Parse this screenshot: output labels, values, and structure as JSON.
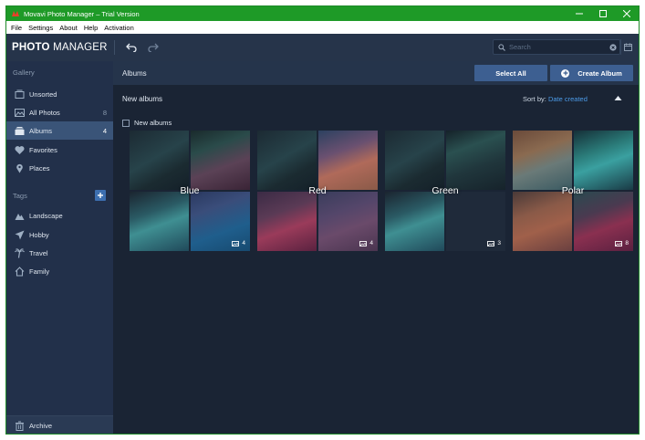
{
  "window": {
    "title": "Movavi Photo Manager – Trial Version",
    "accent_color": "#1e9a27",
    "controls": [
      "minimize-icon",
      "maximize-icon",
      "close-icon"
    ]
  },
  "menu": [
    "File",
    "Settings",
    "About",
    "Help",
    "Activation"
  ],
  "toolbar": {
    "logo_bold": "PHOTO",
    "logo_light": " MANAGER",
    "undo_icon": "undo-icon",
    "redo_icon": "redo-icon",
    "search_placeholder": "Search",
    "calendar_icon": "calendar-icon"
  },
  "sidebar": {
    "gallery_heading": "Gallery",
    "gallery_items": [
      {
        "label": "Unsorted",
        "count": "",
        "icon": "unsorted-icon"
      },
      {
        "label": "All Photos",
        "count": "8",
        "icon": "photos-icon"
      },
      {
        "label": "Albums",
        "count": "4",
        "icon": "albums-icon",
        "active": true
      },
      {
        "label": "Favorites",
        "count": "",
        "icon": "heart-icon"
      },
      {
        "label": "Places",
        "count": "",
        "icon": "pin-icon"
      }
    ],
    "tags_heading": "Tags",
    "tags": [
      {
        "label": "Landscape",
        "icon": "mountain-icon"
      },
      {
        "label": "Hobby",
        "icon": "plane-icon"
      },
      {
        "label": "Travel",
        "icon": "palm-icon"
      },
      {
        "label": "Family",
        "icon": "house-icon"
      }
    ],
    "archive_label": "Archive"
  },
  "main": {
    "header_title": "Albums",
    "select_all_label": "Select All",
    "create_album_label": "Create Album",
    "section_title": "New albums",
    "sort_label": "Sort by:",
    "sort_value": "Date created",
    "group_checkbox_label": "New albums",
    "albums": [
      {
        "name": "Blue",
        "count": "4"
      },
      {
        "name": "Red",
        "count": "4"
      },
      {
        "name": "Green",
        "count": "3"
      },
      {
        "name": "Polar",
        "count": "8"
      }
    ]
  },
  "colors": {
    "sidebar_bg": "#22304a",
    "main_bg": "#1a2434",
    "active_item": "#3a5478",
    "button_bg": "#3d5f91",
    "link": "#4c9be8"
  }
}
